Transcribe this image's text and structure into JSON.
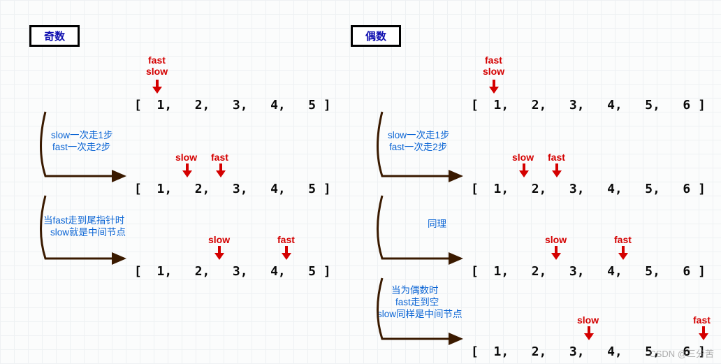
{
  "titles": {
    "odd": "奇数",
    "even": "偶数"
  },
  "pointer_labels": {
    "fast": "fast",
    "slow": "slow"
  },
  "odd": {
    "arrays": {
      "r1": "[  1,   2,   3,   4,   5 ]",
      "r2": "[  1,   2,   3,   4,   5 ]",
      "r3": "[  1,   2,   3,   4,   5 ]"
    },
    "notes": {
      "n1a": "slow一次走1步",
      "n1b": "fast一次走2步",
      "n2a": "当fast走到尾指针时",
      "n2b": "slow就是中间节点"
    }
  },
  "even": {
    "arrays": {
      "r1": "[  1,   2,   3,   4,   5,   6 ]",
      "r2": "[  1,   2,   3,   4,   5,   6 ]",
      "r3": "[  1,   2,   3,   4,   5,   6 ]",
      "r4": "[  1,   2,   3,   4,   5,   6 ]"
    },
    "notes": {
      "n1a": "slow一次走1步",
      "n1b": "fast一次走2步",
      "n2": "同理",
      "n3a": "当为偶数时",
      "n3b": "fast走到空",
      "n3c": "slow同样是中间节点"
    }
  },
  "watermark": "CSDN @三分苦",
  "chart_data": {
    "type": "diagram",
    "description": "Fast-slow pointer technique to find middle of linked list",
    "odd_case": {
      "list": [
        1,
        2,
        3,
        4,
        5
      ],
      "steps": [
        {
          "slow_index": 0,
          "fast_index": 0
        },
        {
          "slow_index": 1,
          "fast_index": 2
        },
        {
          "slow_index": 2,
          "fast_index": 4
        }
      ],
      "middle_value": 3
    },
    "even_case": {
      "list": [
        1,
        2,
        3,
        4,
        5,
        6
      ],
      "steps": [
        {
          "slow_index": 0,
          "fast_index": 0
        },
        {
          "slow_index": 1,
          "fast_index": 2
        },
        {
          "slow_index": 2,
          "fast_index": 4
        },
        {
          "slow_index": 3,
          "fast_index": null
        }
      ],
      "middle_value": 4
    }
  }
}
